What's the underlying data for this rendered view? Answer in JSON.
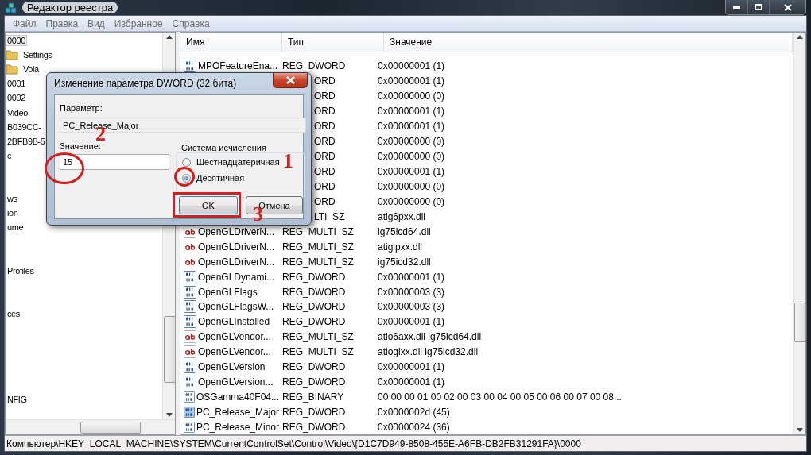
{
  "window": {
    "title": "Редактор реестра"
  },
  "menu": [
    "Файл",
    "Правка",
    "Вид",
    "Избранное",
    "Справка"
  ],
  "tree": [
    {
      "label": "0000",
      "folder": false,
      "selected": true
    },
    {
      "label": "Settings",
      "folder": true,
      "selected": false
    },
    {
      "label": "Vola",
      "folder": true,
      "selected": false
    },
    {
      "label": "0001",
      "folder": false,
      "selected": false
    },
    {
      "label": "0002",
      "folder": false,
      "selected": false
    },
    {
      "label": "Video",
      "folder": false,
      "selected": false
    },
    {
      "label": "B039CC-",
      "folder": false,
      "selected": false
    },
    {
      "label": "2BFB9B-5",
      "folder": false,
      "selected": false
    },
    {
      "label": "c",
      "folder": false,
      "selected": false
    },
    {
      "label": "ws",
      "folder": false,
      "selected": false
    },
    {
      "label": "ion",
      "folder": false,
      "selected": false
    },
    {
      "label": "ume",
      "folder": false,
      "selected": false
    },
    {
      "label": "Profiles",
      "folder": false,
      "selected": false
    },
    {
      "label": "ces",
      "folder": false,
      "selected": false
    },
    {
      "label": "NFIG",
      "folder": false,
      "selected": false
    }
  ],
  "table": {
    "columns": [
      "Имя",
      "Тип",
      "Значение"
    ],
    "rows": [
      {
        "kind": "dword",
        "name": "MPOFeatureEna...",
        "type": "REG_DWORD",
        "value": "0x00000001 (1)",
        "selected": false
      },
      {
        "kind": "covered",
        "type": "ORD",
        "value": "0x00000001 (1)",
        "selected": false
      },
      {
        "kind": "covered",
        "type": "ORD",
        "value": "0x00000000 (0)",
        "selected": false
      },
      {
        "kind": "covered",
        "type": "ORD",
        "value": "0x00000001 (1)",
        "selected": false
      },
      {
        "kind": "covered",
        "type": "ORD",
        "value": "0x00000001 (1)",
        "selected": false
      },
      {
        "kind": "covered",
        "type": "ORD",
        "value": "0x00000000 (0)",
        "selected": false
      },
      {
        "kind": "covered",
        "type": "ORD",
        "value": "0x00000000 (0)",
        "selected": false
      },
      {
        "kind": "covered",
        "type": "ORD",
        "value": "0x00000001 (1)",
        "selected": false
      },
      {
        "kind": "covered",
        "type": "ORD",
        "value": "0x00000000 (0)",
        "selected": false
      },
      {
        "kind": "covered",
        "type": "ORD",
        "value": "0x00000000 (0)",
        "selected": false
      },
      {
        "kind": "covered",
        "type": "LTI_SZ",
        "value": "atig6pxx.dll",
        "selected": false
      },
      {
        "kind": "string",
        "name": "OpenGLDriverN...",
        "type": "REG_MULTI_SZ",
        "value": "ig75icd64.dll",
        "selected": false
      },
      {
        "kind": "string",
        "name": "OpenGLDriverN...",
        "type": "REG_MULTI_SZ",
        "value": "atiglpxx.dll",
        "selected": false
      },
      {
        "kind": "string",
        "name": "OpenGLDriverN...",
        "type": "REG_MULTI_SZ",
        "value": "ig75icd32.dll",
        "selected": false
      },
      {
        "kind": "dword",
        "name": "OpenGLDynami...",
        "type": "REG_DWORD",
        "value": "0x00000001 (1)",
        "selected": false
      },
      {
        "kind": "dword",
        "name": "OpenGLFlags",
        "type": "REG_DWORD",
        "value": "0x00000003 (3)",
        "selected": false
      },
      {
        "kind": "dword",
        "name": "OpenGLFlagsW...",
        "type": "REG_DWORD",
        "value": "0x00000003 (3)",
        "selected": false
      },
      {
        "kind": "dword",
        "name": "OpenGLInstalled",
        "type": "REG_DWORD",
        "value": "0x00000001 (1)",
        "selected": false
      },
      {
        "kind": "string",
        "name": "OpenGLVendor...",
        "type": "REG_MULTI_SZ",
        "value": "atio6axx.dll ig75icd64.dll",
        "selected": false
      },
      {
        "kind": "string",
        "name": "OpenGLVendor...",
        "type": "REG_MULTI_SZ",
        "value": "atioglxx.dll ig75icd32.dll",
        "selected": false
      },
      {
        "kind": "dword",
        "name": "OpenGLVersion",
        "type": "REG_DWORD",
        "value": "0x00000001 (1)",
        "selected": false
      },
      {
        "kind": "dword",
        "name": "OpenGLVersion...",
        "type": "REG_DWORD",
        "value": "0x00000001 (1)",
        "selected": false
      },
      {
        "kind": "dword",
        "name": "OSGamma40F04...",
        "type": "REG_BINARY",
        "value": "00 00 00 01 00 02 00 03 00 04 00 05 00 06 00 07 00 08...",
        "selected": false
      },
      {
        "kind": "dword",
        "name": "PC_Release_Major",
        "type": "REG_DWORD",
        "value": "0x0000002d (45)",
        "selected": true
      },
      {
        "kind": "dword",
        "name": "PC_Release_Minor",
        "type": "REG_DWORD",
        "value": "0x00000024 (36)",
        "selected": false
      }
    ]
  },
  "status_bar": "Компьютер\\HKEY_LOCAL_MACHINE\\SYSTEM\\CurrentControlSet\\Control\\Video\\{D1C7D949-8508-455E-A6FB-DB2FB31291FA}\\0000",
  "dialog": {
    "title": "Изменение параметра DWORD (32 бита)",
    "parameter_label": "Параметр:",
    "parameter_value": "PC_Release_Major",
    "value_label": "Значение:",
    "value": "15",
    "base_group": "Система исчисления",
    "bases": [
      {
        "label": "Шестнадцатеричная",
        "selected": false
      },
      {
        "label": "Десятичная",
        "selected": true
      }
    ],
    "buttons": [
      "OK",
      "Отмена"
    ]
  },
  "annotations": [
    {
      "label": "1"
    },
    {
      "label": "2"
    },
    {
      "label": "3"
    }
  ]
}
